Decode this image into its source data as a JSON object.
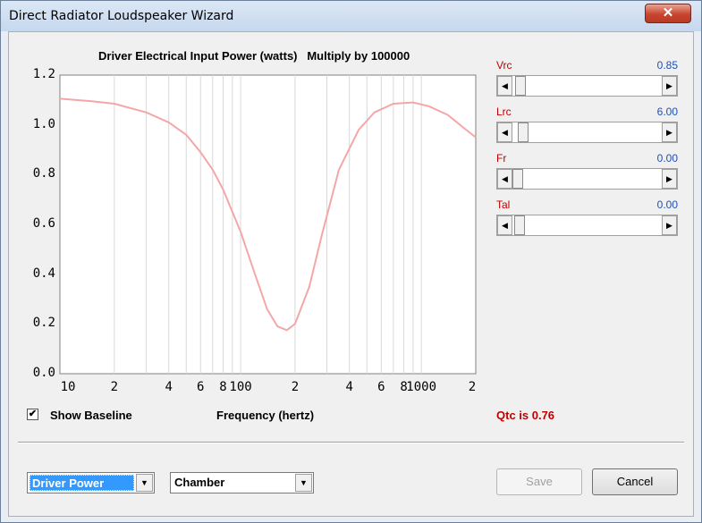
{
  "window": {
    "title": "Direct Radiator Loudspeaker Wizard",
    "close_glyph": "✕"
  },
  "chart_data": {
    "type": "line",
    "title": "Driver Electrical Input Power (watts)   Multiply by 100000",
    "xlabel": "Frequency (hertz)",
    "x_scale": "log",
    "xlim": [
      10,
      2000
    ],
    "ylim": [
      0.0,
      1.2
    ],
    "y_ticks": [
      "1.2",
      "1.0",
      "0.8",
      "0.6",
      "0.4",
      "0.2",
      "0.0"
    ],
    "x_ticks": [
      "10",
      "2",
      "4",
      "6",
      "8",
      "100",
      "2",
      "4",
      "6",
      "8",
      "1000",
      "2"
    ],
    "series": [
      {
        "color": "#f4a7a7",
        "x": [
          10,
          15,
          20,
          30,
          40,
          50,
          60,
          70,
          80,
          100,
          120,
          140,
          160,
          180,
          200,
          240,
          280,
          350,
          450,
          550,
          700,
          900,
          1100,
          1400,
          1700,
          2000
        ],
        "y": [
          1.105,
          1.095,
          1.085,
          1.05,
          1.01,
          0.96,
          0.89,
          0.82,
          0.74,
          0.57,
          0.4,
          0.26,
          0.19,
          0.175,
          0.2,
          0.35,
          0.55,
          0.82,
          0.98,
          1.05,
          1.085,
          1.09,
          1.075,
          1.04,
          0.99,
          0.95
        ]
      }
    ],
    "grid": true
  },
  "params": [
    {
      "name": "Vrc",
      "value": "0.85",
      "position": 0.02
    },
    {
      "name": "Lrc",
      "value": "6.00",
      "position": 0.04
    },
    {
      "name": "Fr",
      "value": "0.00",
      "position": 0.0
    },
    {
      "name": "Tal",
      "value": "0.00",
      "position": 0.015
    }
  ],
  "baseline": {
    "label": "Show Baseline",
    "checked": true,
    "check_glyph": "✔"
  },
  "qtc": "Qtc is 0.76",
  "combos": {
    "plot_select": "Driver Power",
    "box_type": "Chamber",
    "arrow_glyph": "▼"
  },
  "buttons": {
    "save": "Save",
    "cancel": "Cancel"
  },
  "scroll_glyphs": {
    "left": "◀",
    "right": "▶"
  }
}
